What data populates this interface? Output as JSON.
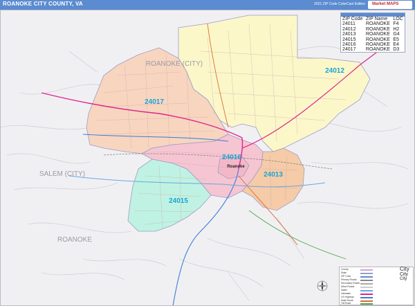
{
  "header": {
    "title": "ROANOKE CITY COUNTY, VA",
    "edition": "2021 ZIP Code ColorCast Edition",
    "brand": "Market MAPS"
  },
  "map": {
    "zip_labels": [
      {
        "code": "24012",
        "color": "#1aa3d6"
      },
      {
        "code": "24017",
        "color": "#1aa3d6"
      },
      {
        "code": "24016",
        "color": "#1aa3d6"
      },
      {
        "code": "24013",
        "color": "#1aa3d6"
      },
      {
        "code": "24015",
        "color": "#1aa3d6"
      }
    ],
    "place_labels": {
      "roanoke_city_top": "ROANOKE (CITY)",
      "salem_city": "SALEM (CITY)",
      "roanoke_bottom": "ROANOKE",
      "roanoke_downtown": "Roanoke"
    },
    "zone_colors": {
      "24012": "#fbf7c9",
      "24017": "#f7d5bf",
      "24016": "#f6c5d2",
      "24013": "#f5cba8",
      "24015": "#bff2e2",
      "outside": "#f0f0f3"
    },
    "road_colors": {
      "interstate": "#e0228c",
      "us_highway": "#3b7bd6",
      "state_route": "#e06a2c",
      "local": "#b7b7c4"
    }
  },
  "zip_table": {
    "headers": [
      "ZIP Code",
      "ZIP Name",
      "LOC"
    ],
    "rows": [
      [
        "24011",
        "ROANOKE",
        "F4"
      ],
      [
        "24012",
        "ROANOKE",
        "H2"
      ],
      [
        "24013",
        "ROANOKE",
        "G4"
      ],
      [
        "24015",
        "ROANOKE",
        "E5"
      ],
      [
        "24016",
        "ROANOKE",
        "E4"
      ],
      [
        "24017",
        "ROANOKE",
        "D3"
      ]
    ]
  },
  "legend": {
    "rows": [
      "County",
      "State",
      "ZIP Code",
      "Primary Roads",
      "Secondary Roads",
      "Minor Roads",
      "Water",
      "Interstate",
      "US Highway",
      "State Route",
      "Toll Road"
    ],
    "city_key": [
      "City",
      "City",
      "City"
    ]
  }
}
